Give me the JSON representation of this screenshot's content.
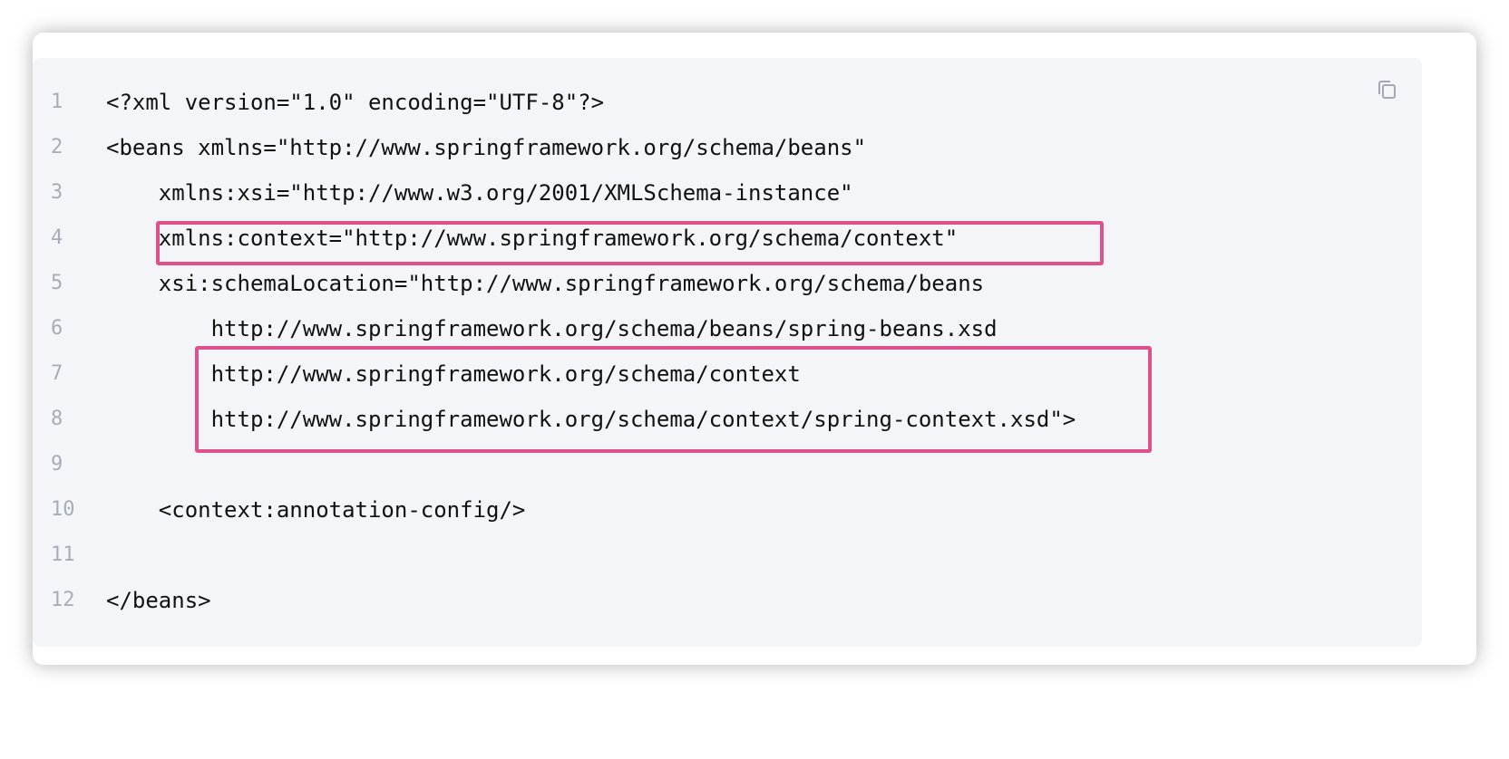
{
  "code": {
    "lines": [
      {
        "n": "1",
        "text": "<?xml version=\"1.0\" encoding=\"UTF-8\"?>"
      },
      {
        "n": "2",
        "text": "<beans xmlns=\"http://www.springframework.org/schema/beans\""
      },
      {
        "n": "3",
        "text": "    xmlns:xsi=\"http://www.w3.org/2001/XMLSchema-instance\""
      },
      {
        "n": "4",
        "text": "    xmlns:context=\"http://www.springframework.org/schema/context\""
      },
      {
        "n": "5",
        "text": "    xsi:schemaLocation=\"http://www.springframework.org/schema/beans"
      },
      {
        "n": "6",
        "text": "        http://www.springframework.org/schema/beans/spring-beans.xsd"
      },
      {
        "n": "7",
        "text": "        http://www.springframework.org/schema/context"
      },
      {
        "n": "8",
        "text": "        http://www.springframework.org/schema/context/spring-context.xsd\">"
      },
      {
        "n": "9",
        "text": ""
      },
      {
        "n": "10",
        "text": "    <context:annotation-config/>"
      },
      {
        "n": "11",
        "text": ""
      },
      {
        "n": "12",
        "text": "</beans>"
      }
    ]
  },
  "icons": {
    "copy": "copy-icon"
  },
  "colors": {
    "highlight": "#e0508a",
    "code_bg": "#f4f5f8",
    "line_number": "#a7adb7"
  }
}
